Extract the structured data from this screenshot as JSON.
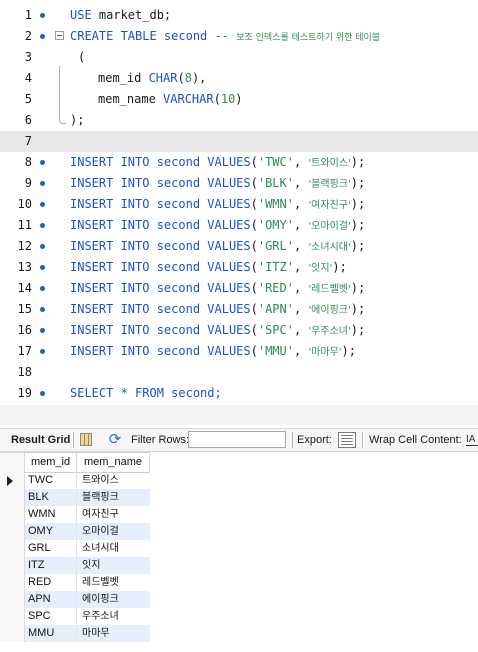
{
  "editor": {
    "lines": [
      {
        "n": "1",
        "dot": true,
        "indent": 0,
        "tokens": [
          {
            "t": "USE",
            "c": "kw"
          },
          {
            "t": " market_db;",
            "c": ""
          }
        ]
      },
      {
        "n": "2",
        "dot": true,
        "indent": 0,
        "tokens": [
          {
            "t": "CREATE TABLE second",
            "c": "kw"
          },
          {
            "t": " -- ",
            "c": "cm"
          },
          {
            "t": "보조 인덱스를 테스트하기 위한 테이블",
            "c": "cm cm-ko"
          }
        ]
      },
      {
        "n": "3",
        "dot": false,
        "indent": 1,
        "tokens": [
          {
            "t": "(",
            "c": ""
          }
        ]
      },
      {
        "n": "4",
        "dot": false,
        "indent": 2,
        "tokens": [
          {
            "t": "mem_id ",
            "c": ""
          },
          {
            "t": "CHAR",
            "c": "kw"
          },
          {
            "t": "(",
            "c": ""
          },
          {
            "t": "8",
            "c": "str"
          },
          {
            "t": "),",
            "c": ""
          }
        ]
      },
      {
        "n": "5",
        "dot": false,
        "indent": 2,
        "tokens": [
          {
            "t": "mem_name ",
            "c": ""
          },
          {
            "t": "VARCHAR",
            "c": "kw"
          },
          {
            "t": "(",
            "c": ""
          },
          {
            "t": "10",
            "c": "str"
          },
          {
            "t": ")",
            "c": ""
          }
        ]
      },
      {
        "n": "6",
        "dot": false,
        "indent": 0,
        "tokens": [
          {
            "t": ");",
            "c": ""
          }
        ]
      },
      {
        "n": "7",
        "dot": false,
        "indent": 0,
        "current": true,
        "tokens": []
      },
      {
        "n": "8",
        "dot": true,
        "indent": 0,
        "tokens": [
          {
            "t": "INSERT INTO second VALUES",
            "c": "kw"
          },
          {
            "t": "(",
            "c": ""
          },
          {
            "t": "'TWC'",
            "c": "str"
          },
          {
            "t": ", ",
            "c": ""
          },
          {
            "t": "'트와이스'",
            "c": "str str-ko"
          },
          {
            "t": ");",
            "c": ""
          }
        ]
      },
      {
        "n": "9",
        "dot": true,
        "indent": 0,
        "tokens": [
          {
            "t": "INSERT INTO second VALUES",
            "c": "kw"
          },
          {
            "t": "(",
            "c": ""
          },
          {
            "t": "'BLK'",
            "c": "str"
          },
          {
            "t": ", ",
            "c": ""
          },
          {
            "t": "'블랙핑크'",
            "c": "str str-ko"
          },
          {
            "t": ");",
            "c": ""
          }
        ]
      },
      {
        "n": "10",
        "dot": true,
        "indent": 0,
        "tokens": [
          {
            "t": "INSERT INTO second VALUES",
            "c": "kw"
          },
          {
            "t": "(",
            "c": ""
          },
          {
            "t": "'WMN'",
            "c": "str"
          },
          {
            "t": ", ",
            "c": ""
          },
          {
            "t": "'여자친구'",
            "c": "str str-ko"
          },
          {
            "t": ");",
            "c": ""
          }
        ]
      },
      {
        "n": "11",
        "dot": true,
        "indent": 0,
        "tokens": [
          {
            "t": "INSERT INTO second VALUES",
            "c": "kw"
          },
          {
            "t": "(",
            "c": ""
          },
          {
            "t": "'OMY'",
            "c": "str"
          },
          {
            "t": ", ",
            "c": ""
          },
          {
            "t": "'오마이걸'",
            "c": "str str-ko"
          },
          {
            "t": ");",
            "c": ""
          }
        ]
      },
      {
        "n": "12",
        "dot": true,
        "indent": 0,
        "tokens": [
          {
            "t": "INSERT INTO second VALUES",
            "c": "kw"
          },
          {
            "t": "(",
            "c": ""
          },
          {
            "t": "'GRL'",
            "c": "str"
          },
          {
            "t": ", ",
            "c": ""
          },
          {
            "t": "'소녀시대'",
            "c": "str str-ko"
          },
          {
            "t": ");",
            "c": ""
          }
        ]
      },
      {
        "n": "13",
        "dot": true,
        "indent": 0,
        "tokens": [
          {
            "t": "INSERT INTO second VALUES",
            "c": "kw"
          },
          {
            "t": "(",
            "c": ""
          },
          {
            "t": "'ITZ'",
            "c": "str"
          },
          {
            "t": ", ",
            "c": ""
          },
          {
            "t": "'잇지'",
            "c": "str str-ko"
          },
          {
            "t": ");",
            "c": ""
          }
        ]
      },
      {
        "n": "14",
        "dot": true,
        "indent": 0,
        "tokens": [
          {
            "t": "INSERT INTO second VALUES",
            "c": "kw"
          },
          {
            "t": "(",
            "c": ""
          },
          {
            "t": "'RED'",
            "c": "str"
          },
          {
            "t": ", ",
            "c": ""
          },
          {
            "t": "'레드벨벳'",
            "c": "str str-ko"
          },
          {
            "t": ");",
            "c": ""
          }
        ]
      },
      {
        "n": "15",
        "dot": true,
        "indent": 0,
        "tokens": [
          {
            "t": "INSERT INTO second VALUES",
            "c": "kw"
          },
          {
            "t": "(",
            "c": ""
          },
          {
            "t": "'APN'",
            "c": "str"
          },
          {
            "t": ", ",
            "c": ""
          },
          {
            "t": "'에이핑크'",
            "c": "str str-ko"
          },
          {
            "t": ");",
            "c": ""
          }
        ]
      },
      {
        "n": "16",
        "dot": true,
        "indent": 0,
        "tokens": [
          {
            "t": "INSERT INTO second VALUES",
            "c": "kw"
          },
          {
            "t": "(",
            "c": ""
          },
          {
            "t": "'SPC'",
            "c": "str"
          },
          {
            "t": ", ",
            "c": ""
          },
          {
            "t": "'우주소녀'",
            "c": "str str-ko"
          },
          {
            "t": ");",
            "c": ""
          }
        ]
      },
      {
        "n": "17",
        "dot": true,
        "indent": 0,
        "tokens": [
          {
            "t": "INSERT INTO second VALUES",
            "c": "kw"
          },
          {
            "t": "(",
            "c": ""
          },
          {
            "t": "'MMU'",
            "c": "str"
          },
          {
            "t": ", ",
            "c": ""
          },
          {
            "t": "'마마무'",
            "c": "str str-ko"
          },
          {
            "t": ");",
            "c": ""
          }
        ]
      },
      {
        "n": "18",
        "dot": false,
        "indent": 0,
        "tokens": []
      },
      {
        "n": "19",
        "dot": true,
        "indent": 0,
        "tokens": [
          {
            "t": "SELECT * FROM second;",
            "c": "kw"
          }
        ]
      }
    ]
  },
  "toolbar": {
    "result_grid_label": "Result Grid",
    "filter_rows_label": "Filter Rows:",
    "filter_value": "",
    "export_label": "Export:",
    "wrap_label": "Wrap Cell Content:",
    "icons": [
      "grid-icon",
      "refresh-icon",
      "export-icon",
      "wrap-icon"
    ]
  },
  "result_grid": {
    "columns": [
      "mem_id",
      "mem_name"
    ],
    "rows": [
      [
        "TWC",
        "트와이스"
      ],
      [
        "BLK",
        "블랙핑크"
      ],
      [
        "WMN",
        "여자친구"
      ],
      [
        "OMY",
        "오마이걸"
      ],
      [
        "GRL",
        "소녀시대"
      ],
      [
        "ITZ",
        "잇지"
      ],
      [
        "RED",
        "레드벨벳"
      ],
      [
        "APN",
        "에이핑크"
      ],
      [
        "SPC",
        "우주소녀"
      ],
      [
        "MMU",
        "마마무"
      ]
    ],
    "selected_row": 0
  },
  "colors": {
    "keyword": "#1e4fd8",
    "string": "#2e8b57",
    "current_line": "#e8e8e8",
    "alt_row": "#e6eefb",
    "statement_dot": "#1e5fc8"
  }
}
